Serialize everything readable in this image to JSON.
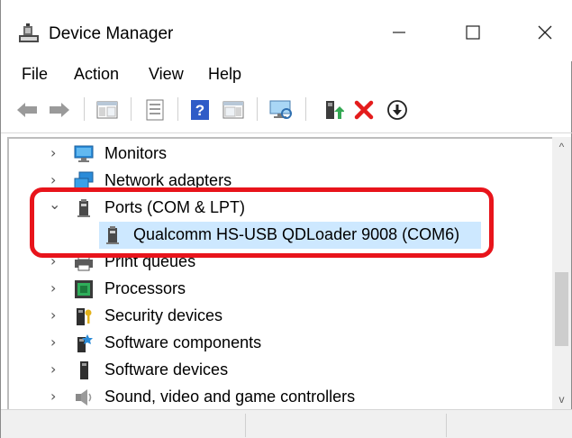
{
  "window": {
    "title": "Device Manager",
    "app_icon": "device-manager-icon",
    "controls": [
      "minimize",
      "maximize",
      "close"
    ],
    "control_glyphs": {
      "minimize": "—",
      "maximize": "☐",
      "close": "✕"
    }
  },
  "menu": {
    "items": [
      {
        "label": "File"
      },
      {
        "label": "Action"
      },
      {
        "label": "View"
      },
      {
        "label": "Help"
      }
    ]
  },
  "toolbar": {
    "buttons": [
      {
        "name": "back-icon"
      },
      {
        "name": "forward-icon"
      },
      {
        "name": "show-hide-console-tree-icon"
      },
      {
        "name": "properties-icon"
      },
      {
        "name": "help-icon",
        "glyph": "?"
      },
      {
        "name": "show-hide-action-pane-icon"
      },
      {
        "name": "scan-for-hardware-changes-icon"
      },
      {
        "name": "update-driver-icon"
      },
      {
        "name": "uninstall-device-icon",
        "glyph": "✕"
      },
      {
        "name": "disable-device-icon",
        "glyph": "⬇"
      }
    ]
  },
  "tree": {
    "rows": [
      {
        "label": "Monitors",
        "icon": "monitor-icon",
        "expander": "›",
        "expanded": false
      },
      {
        "label": "Network adapters",
        "icon": "network-adapter-icon",
        "expander": "›",
        "expanded": false
      },
      {
        "label": "Ports (COM & LPT)",
        "icon": "port-icon",
        "expander": "⌄",
        "expanded": true
      },
      {
        "label": "Qualcomm HS-USB QDLoader 9008 (COM6)",
        "icon": "port-device-icon",
        "selected": true,
        "child": true
      },
      {
        "label": "Print queues",
        "icon": "printer-icon",
        "expander": "›",
        "expanded": false
      },
      {
        "label": "Processors",
        "icon": "processor-icon",
        "expander": "›",
        "expanded": false
      },
      {
        "label": "Security devices",
        "icon": "security-device-icon",
        "expander": "›",
        "expanded": false
      },
      {
        "label": "Software components",
        "icon": "software-component-icon",
        "expander": "›",
        "expanded": false
      },
      {
        "label": "Software devices",
        "icon": "software-device-icon",
        "expander": "›",
        "expanded": false
      },
      {
        "label": "Sound, video and game controllers",
        "icon": "sound-controller-icon",
        "expander": "›",
        "expanded": false
      }
    ]
  },
  "scrollbar": {
    "up": "^",
    "down": "v",
    "position": 0.5
  },
  "colors": {
    "selection": "#cde8ff",
    "highlight": "#e8141b"
  }
}
